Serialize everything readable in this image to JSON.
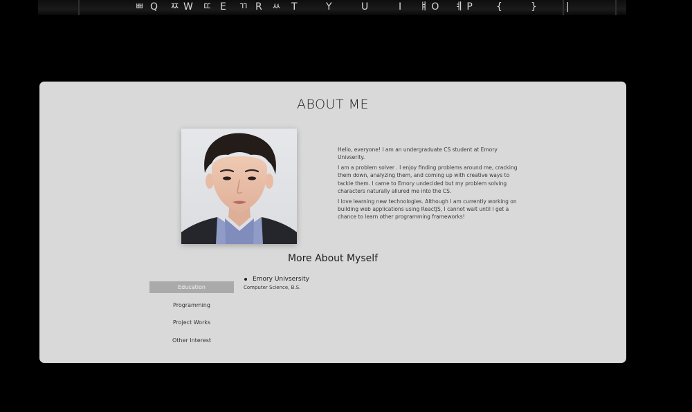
{
  "banner": {
    "keys": [
      "ㅃ",
      "Q",
      "ㅉ",
      "W",
      "ㄸ",
      "E",
      "ㄲ",
      "R",
      "ㅆ",
      "T",
      "Y",
      "U",
      "I",
      "ㅒ O",
      "ㅖ P",
      "{",
      "}",
      "|"
    ]
  },
  "about": {
    "title": "ABOUT ME",
    "photo_alt": "Profile photo",
    "bio": [
      "Hello, everyone! I am an undergraduate CS student at Emory Univserity.",
      "I am a problem solver . I enjoy finding problems around me, cracking them down, analyzing them, and coming up with creative ways to tackle them. I came to Emory undecided but my problem solving characters naturally allured me into the CS.",
      "I love learning new technologies. Although I am currently working on building web applications using ReactJS, I cannot wait until I get a chance to learn other programming frameworks!"
    ]
  },
  "more": {
    "title": "More About Myself",
    "tabs": [
      {
        "label": "Education",
        "active": true
      },
      {
        "label": "Programming",
        "active": false
      },
      {
        "label": "Project Works",
        "active": false
      },
      {
        "label": "Other Interest",
        "active": false
      }
    ],
    "education": {
      "school": "Emory Univsersity",
      "degree": "Computer Science, B.S."
    }
  },
  "colors": {
    "background": "#000000",
    "card": "#d9d9d9",
    "active_tab": "#aaaaaa"
  }
}
